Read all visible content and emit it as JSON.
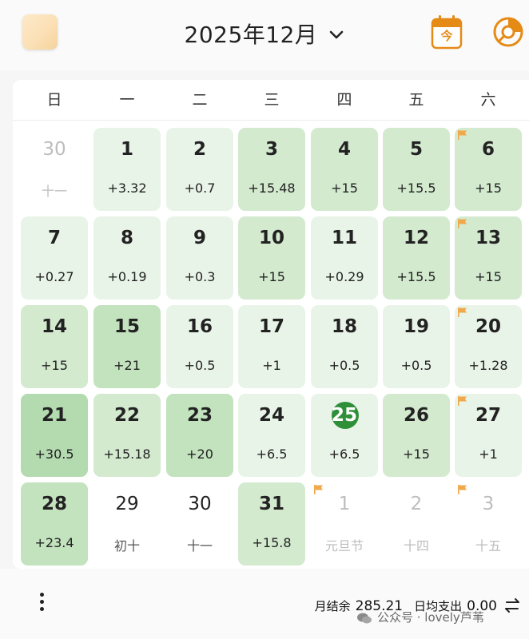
{
  "header": {
    "title": "2025年12月",
    "today_label": "今"
  },
  "weekdays": [
    "日",
    "一",
    "二",
    "三",
    "四",
    "五",
    "六"
  ],
  "days": [
    {
      "num": "30",
      "sub": "十一",
      "style": "muted",
      "shade": 0,
      "flag": false
    },
    {
      "num": "1",
      "sub": "+3.32",
      "style": "normal",
      "shade": 1,
      "flag": false
    },
    {
      "num": "2",
      "sub": "+0.7",
      "style": "normal",
      "shade": 1,
      "flag": false
    },
    {
      "num": "3",
      "sub": "+15.48",
      "style": "normal",
      "shade": 2,
      "flag": false
    },
    {
      "num": "4",
      "sub": "+15",
      "style": "normal",
      "shade": 2,
      "flag": false
    },
    {
      "num": "5",
      "sub": "+15.5",
      "style": "normal",
      "shade": 2,
      "flag": false
    },
    {
      "num": "6",
      "sub": "+15",
      "style": "normal",
      "shade": 2,
      "flag": true
    },
    {
      "num": "7",
      "sub": "+0.27",
      "style": "normal",
      "shade": 1,
      "flag": false
    },
    {
      "num": "8",
      "sub": "+0.19",
      "style": "normal",
      "shade": 1,
      "flag": false
    },
    {
      "num": "9",
      "sub": "+0.3",
      "style": "normal",
      "shade": 1,
      "flag": false
    },
    {
      "num": "10",
      "sub": "+15",
      "style": "normal",
      "shade": 2,
      "flag": false
    },
    {
      "num": "11",
      "sub": "+0.29",
      "style": "normal",
      "shade": 1,
      "flag": false
    },
    {
      "num": "12",
      "sub": "+15.5",
      "style": "normal",
      "shade": 2,
      "flag": false
    },
    {
      "num": "13",
      "sub": "+15",
      "style": "normal",
      "shade": 2,
      "flag": true
    },
    {
      "num": "14",
      "sub": "+15",
      "style": "normal",
      "shade": 2,
      "flag": false
    },
    {
      "num": "15",
      "sub": "+21",
      "style": "normal",
      "shade": 3,
      "flag": false
    },
    {
      "num": "16",
      "sub": "+0.5",
      "style": "normal",
      "shade": 1,
      "flag": false
    },
    {
      "num": "17",
      "sub": "+1",
      "style": "normal",
      "shade": 1,
      "flag": false
    },
    {
      "num": "18",
      "sub": "+0.5",
      "style": "normal",
      "shade": 1,
      "flag": false
    },
    {
      "num": "19",
      "sub": "+0.5",
      "style": "normal",
      "shade": 1,
      "flag": false
    },
    {
      "num": "20",
      "sub": "+1.28",
      "style": "normal",
      "shade": 1,
      "flag": true
    },
    {
      "num": "21",
      "sub": "+30.5",
      "style": "normal",
      "shade": 4,
      "flag": false
    },
    {
      "num": "22",
      "sub": "+15.18",
      "style": "normal",
      "shade": 2,
      "flag": false
    },
    {
      "num": "23",
      "sub": "+20",
      "style": "normal",
      "shade": 3,
      "flag": false
    },
    {
      "num": "24",
      "sub": "+6.5",
      "style": "normal",
      "shade": 1,
      "flag": false
    },
    {
      "num": "25",
      "sub": "+6.5",
      "style": "today",
      "shade": 1,
      "flag": false
    },
    {
      "num": "26",
      "sub": "+15",
      "style": "normal",
      "shade": 2,
      "flag": false
    },
    {
      "num": "27",
      "sub": "+1",
      "style": "normal",
      "shade": 1,
      "flag": true
    },
    {
      "num": "28",
      "sub": "+23.4",
      "style": "normal",
      "shade": 3,
      "flag": false
    },
    {
      "num": "29",
      "sub": "初十",
      "style": "lunar",
      "shade": 0,
      "flag": false
    },
    {
      "num": "30",
      "sub": "十一",
      "style": "lunar",
      "shade": 0,
      "flag": false
    },
    {
      "num": "31",
      "sub": "+15.8",
      "style": "normal",
      "shade": 2,
      "flag": false
    },
    {
      "num": "1",
      "sub": "元旦节",
      "style": "muted",
      "shade": 0,
      "flag": true
    },
    {
      "num": "2",
      "sub": "十四",
      "style": "muted",
      "shade": 0,
      "flag": false
    },
    {
      "num": "3",
      "sub": "十五",
      "style": "muted",
      "shade": 0,
      "flag": true
    }
  ],
  "colors": {
    "shade1": "#e9f4e8",
    "shade2": "#d3eacf",
    "shade3": "#c3e2be",
    "shade4": "#b4dab0",
    "today": "#2f8f39",
    "flag": "#f0a84a",
    "accent": "#e58a15"
  },
  "footer": {
    "balance_label": "月结余",
    "balance_value": "285.21",
    "avg_label": "日均支出",
    "avg_value": "0.00",
    "watermark": "公众号 · lovely芦苇"
  }
}
